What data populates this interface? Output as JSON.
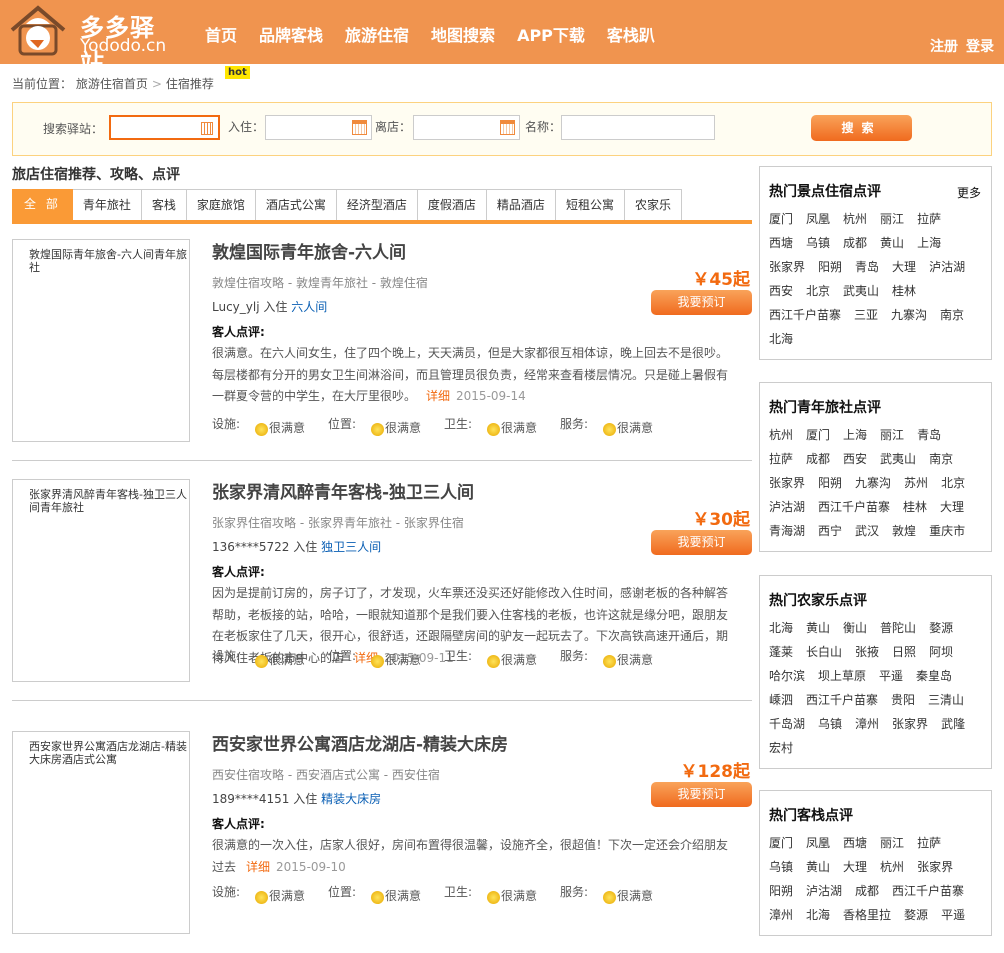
{
  "header": {
    "logo_text": "多多驿站",
    "logo_sub": "Yododo.cn",
    "nav": [
      "首页",
      "品牌客栈",
      "旅游住宿",
      "地图搜索",
      "APP下载",
      "客栈趴"
    ],
    "register": "注册",
    "login": "登录"
  },
  "breadcrumb": {
    "label": "当前位置：",
    "home": "旅游住宿首页",
    "sep": ">",
    "current": "住宿推荐",
    "hot": "hot"
  },
  "search": {
    "station_label": "搜索驿站：",
    "checkin_label": "入住：",
    "checkout_label": "离店：",
    "name_label": "名称：",
    "station_value": "",
    "checkin_value": "",
    "checkout_value": "",
    "name_value": "",
    "button": "搜索"
  },
  "section_title": "旅店住宿推荐、攻略、点评",
  "tabs": [
    "全 部",
    "青年旅社",
    "客栈",
    "家庭旅馆",
    "酒店式公寓",
    "经济型酒店",
    "度假酒店",
    "精品酒店",
    "短租公寓",
    "农家乐"
  ],
  "listings": [
    {
      "thumb": "敦煌国际青年旅舍-六人间青年旅社",
      "title": "敦煌国际青年旅舍-六人间",
      "links": "敦煌住宿攻略  - 敦煌青年旅社  - 敦煌住宿",
      "user": "Lucy_ylj",
      "stay": "入住",
      "room": "六人间",
      "price": "￥45起",
      "book": "我要预订",
      "review_label": "客人点评:",
      "review": "很满意。在六人间女生，住了四个晚上，天天满员，但是大家都很互相体谅，晚上回去不是很吵。每层楼都有分开的男女卫生间淋浴间，而且管理员很负责，经常来查看楼层情况。只是碰上暑假有一群夏令营的中学生，在大厅里很吵。",
      "more": "详细",
      "date": "2015-09-14",
      "ratings": [
        {
          "label": "设施:",
          "value": "很满意"
        },
        {
          "label": "位置:",
          "value": "很满意"
        },
        {
          "label": "卫生:",
          "value": "很满意"
        },
        {
          "label": "服务:",
          "value": "很满意"
        }
      ]
    },
    {
      "thumb": "张家界清风醉青年客栈-独卫三人间青年旅社",
      "title": "张家界清风醉青年客栈-独卫三人间",
      "links": "张家界住宿攻略  - 张家界青年旅社  - 张家界住宿",
      "user": "136****5722",
      "stay": "入住",
      "room": "独卫三人间",
      "price": "￥30起",
      "book": "我要预订",
      "review_label": "客人点评:",
      "review": "因为是提前订房的，房子订了，才发现，火车票还没买还好能修改入住时间，感谢老板的各种解答帮助，老板接的站，哈哈，一眼就知道那个是我们要入住客栈的老板，也许这就是缘分吧，跟朋友在老板家住了几天，很开心，很舒适，还跟隔壁房间的驴友一起玩去了。下次高铁高速开通后，期待入住老板的市中心的店",
      "more": "详细",
      "date": "2015-09-11",
      "ratings": [
        {
          "label": "设施:",
          "value": "很满意"
        },
        {
          "label": "位置:",
          "value": "很满意"
        },
        {
          "label": "卫生:",
          "value": "很满意"
        },
        {
          "label": "服务:",
          "value": "很满意"
        }
      ]
    },
    {
      "thumb": "西安家世界公寓酒店龙湖店-精装大床房酒店式公寓",
      "title": "西安家世界公寓酒店龙湖店-精装大床房",
      "links": "西安住宿攻略  - 西安酒店式公寓  - 西安住宿",
      "user": "189****4151",
      "stay": "入住",
      "room": "精装大床房",
      "price": "￥128起",
      "book": "我要预订",
      "review_label": "客人点评:",
      "review": "很满意的一次入住，店家人很好，房间布置得很温馨，设施齐全，很超值！下次一定还会介绍朋友过去",
      "more": "详细",
      "date": "2015-09-10",
      "ratings": [
        {
          "label": "设施:",
          "value": "很满意"
        },
        {
          "label": "位置:",
          "value": "很满意"
        },
        {
          "label": "卫生:",
          "value": "很满意"
        },
        {
          "label": "服务:",
          "value": "很满意"
        }
      ]
    }
  ],
  "sidebar": [
    {
      "title": "热门景点住宿点评",
      "more": "更多",
      "cities": [
        "厦门",
        "凤凰",
        "杭州",
        "丽江",
        "拉萨",
        "西塘",
        "乌镇",
        "成都",
        "黄山",
        "上海",
        "张家界",
        "阳朔",
        "青岛",
        "大理",
        "泸沽湖",
        "西安",
        "北京",
        "武夷山",
        "桂林",
        "西江千户苗寨",
        "三亚",
        "九寨沟",
        "南京",
        "北海"
      ]
    },
    {
      "title": "热门青年旅社点评",
      "cities": [
        "杭州",
        "厦门",
        "上海",
        "丽江",
        "青岛",
        "拉萨",
        "成都",
        "西安",
        "武夷山",
        "南京",
        "张家界",
        "阳朔",
        "九寨沟",
        "苏州",
        "北京",
        "泸沽湖",
        "西江千户苗寨",
        "桂林",
        "大理",
        "青海湖",
        "西宁",
        "武汉",
        "敦煌",
        "重庆市"
      ]
    },
    {
      "title": "热门农家乐点评",
      "cities": [
        "北海",
        "黄山",
        "衡山",
        "普陀山",
        "婺源",
        "蓬莱",
        "长白山",
        "张掖",
        "日照",
        "阿坝",
        "哈尔滨",
        "坝上草原",
        "平遥",
        "秦皇岛",
        "嵊泗",
        "西江千户苗寨",
        "贵阳",
        "三清山",
        "千岛湖",
        "乌镇",
        "漳州",
        "张家界",
        "武隆",
        "宏村"
      ]
    },
    {
      "title": "热门客栈点评",
      "cities": [
        "厦门",
        "凤凰",
        "西塘",
        "丽江",
        "拉萨",
        "乌镇",
        "黄山",
        "大理",
        "杭州",
        "张家界",
        "阳朔",
        "泸沽湖",
        "成都",
        "西江千户苗寨",
        "漳州",
        "北海",
        "香格里拉",
        "婺源",
        "平遥"
      ]
    }
  ],
  "colors": {
    "brand": "#f0944f",
    "accent": "#f26a10",
    "link": "#0a5fb4"
  }
}
